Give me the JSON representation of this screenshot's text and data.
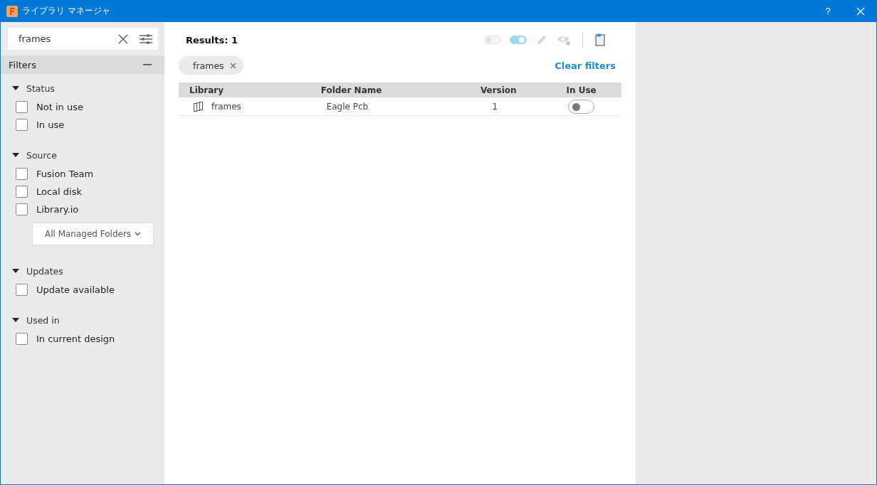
{
  "window": {
    "title": "ライブラリ マネージャ",
    "help": "?"
  },
  "search": {
    "value": "frames"
  },
  "filters": {
    "title": "Filters",
    "groups": [
      {
        "title": "Status",
        "expanded": true,
        "options": [
          {
            "label": "Not in use",
            "checked": false
          },
          {
            "label": "In use",
            "checked": false
          }
        ]
      },
      {
        "title": "Source",
        "expanded": true,
        "options": [
          {
            "label": "Fusion Team",
            "checked": false
          },
          {
            "label": "Local disk",
            "checked": false
          },
          {
            "label": "Library.io",
            "checked": false
          }
        ],
        "dropdown": "All Managed Folders"
      },
      {
        "title": "Updates",
        "expanded": true,
        "options": [
          {
            "label": "Update available",
            "checked": false
          }
        ]
      },
      {
        "title": "Used in",
        "expanded": true,
        "options": [
          {
            "label": "In current design",
            "checked": false
          }
        ]
      }
    ]
  },
  "results": {
    "label": "Results: 1"
  },
  "toolbar": [
    {
      "kind": "toggle",
      "on": false,
      "disabled": true
    },
    {
      "kind": "toggle",
      "on": true,
      "disabled": true
    },
    {
      "kind": "edit"
    },
    {
      "kind": "hide"
    },
    {
      "kind": "export"
    }
  ],
  "chips": [
    {
      "label": "frames"
    }
  ],
  "clear_filters": "Clear filters",
  "table": {
    "columns": [
      "Library",
      "Folder Name",
      "Version",
      "In Use"
    ],
    "rows": [
      {
        "library": "frames",
        "folder": "Eagle Pcb",
        "version": "1",
        "in_use": false
      }
    ]
  }
}
